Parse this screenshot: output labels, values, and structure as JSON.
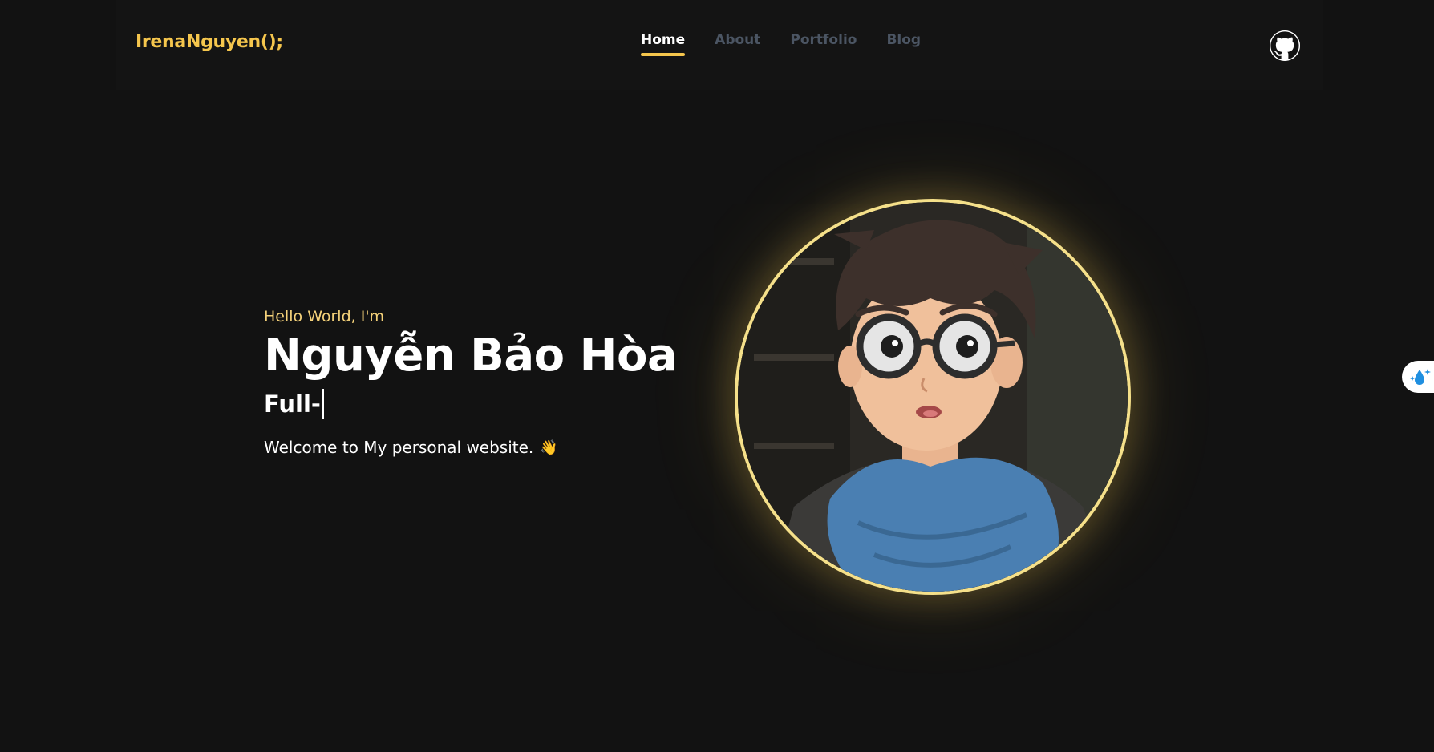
{
  "brand": {
    "logo": "IrenaNguyen();"
  },
  "nav": {
    "items": [
      {
        "label": "Home",
        "active": true
      },
      {
        "label": "About",
        "active": false
      },
      {
        "label": "Portfolio",
        "active": false
      },
      {
        "label": "Blog",
        "active": false
      }
    ]
  },
  "header": {
    "github_icon": "github-icon"
  },
  "hero": {
    "greeting": "Hello World, I'm",
    "name": "Nguyễn Bảo Hòa",
    "role_typed": "Full-",
    "welcome": "Welcome to My personal website.",
    "wave_icon": "👋"
  },
  "avatar": {
    "icon": "avatar-anime-boy"
  },
  "side_widget": {
    "icon": "water-drop-sparkle-icon"
  },
  "colors": {
    "background": "#121212",
    "accent": "#f5c64d",
    "nav_inactive": "#4b5563",
    "ring": "#f5e08a"
  }
}
